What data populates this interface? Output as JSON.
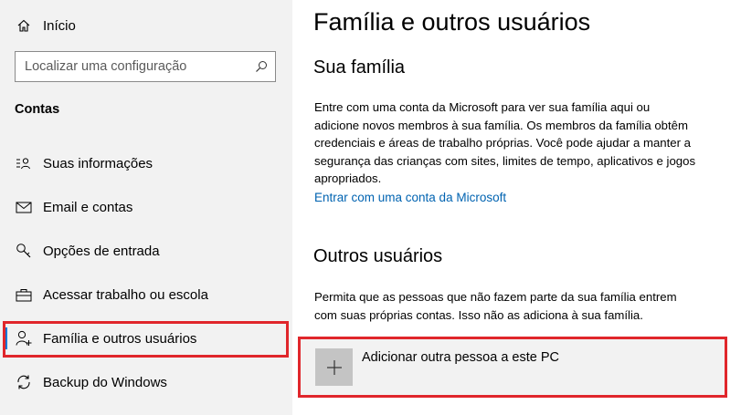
{
  "sidebar": {
    "home_label": "Início",
    "search_placeholder": "Localizar uma configuração",
    "section_title": "Contas",
    "items": [
      {
        "label": "Suas informações",
        "icon": "person-card-icon"
      },
      {
        "label": "Email e contas",
        "icon": "mail-icon"
      },
      {
        "label": "Opções de entrada",
        "icon": "key-icon"
      },
      {
        "label": "Acessar trabalho ou escola",
        "icon": "briefcase-icon"
      },
      {
        "label": "Família e outros usuários",
        "icon": "add-person-icon",
        "selected": true
      },
      {
        "label": "Backup do Windows",
        "icon": "sync-icon"
      }
    ]
  },
  "main": {
    "title": "Família e outros usuários",
    "family": {
      "heading": "Sua família",
      "description": "Entre com uma conta da Microsoft para ver sua família aqui ou adicione novos membros à sua família. Os membros da família obtêm credenciais e áreas de trabalho próprias. Você pode ajudar a manter a segurança das crianças com sites, limites de tempo, aplicativos e jogos apropriados.",
      "link": "Entrar com uma conta da Microsoft"
    },
    "others": {
      "heading": "Outros usuários",
      "description": "Permita que as pessoas que não fazem parte da sua família entrem com suas próprias contas. Isso não as adiciona à sua família.",
      "add_button": "Adicionar outra pessoa a este PC"
    }
  },
  "colors": {
    "accent": "#0078d7",
    "link": "#0063b1",
    "highlight": "#e0262b",
    "sidebar_bg": "#f2f2f2"
  }
}
